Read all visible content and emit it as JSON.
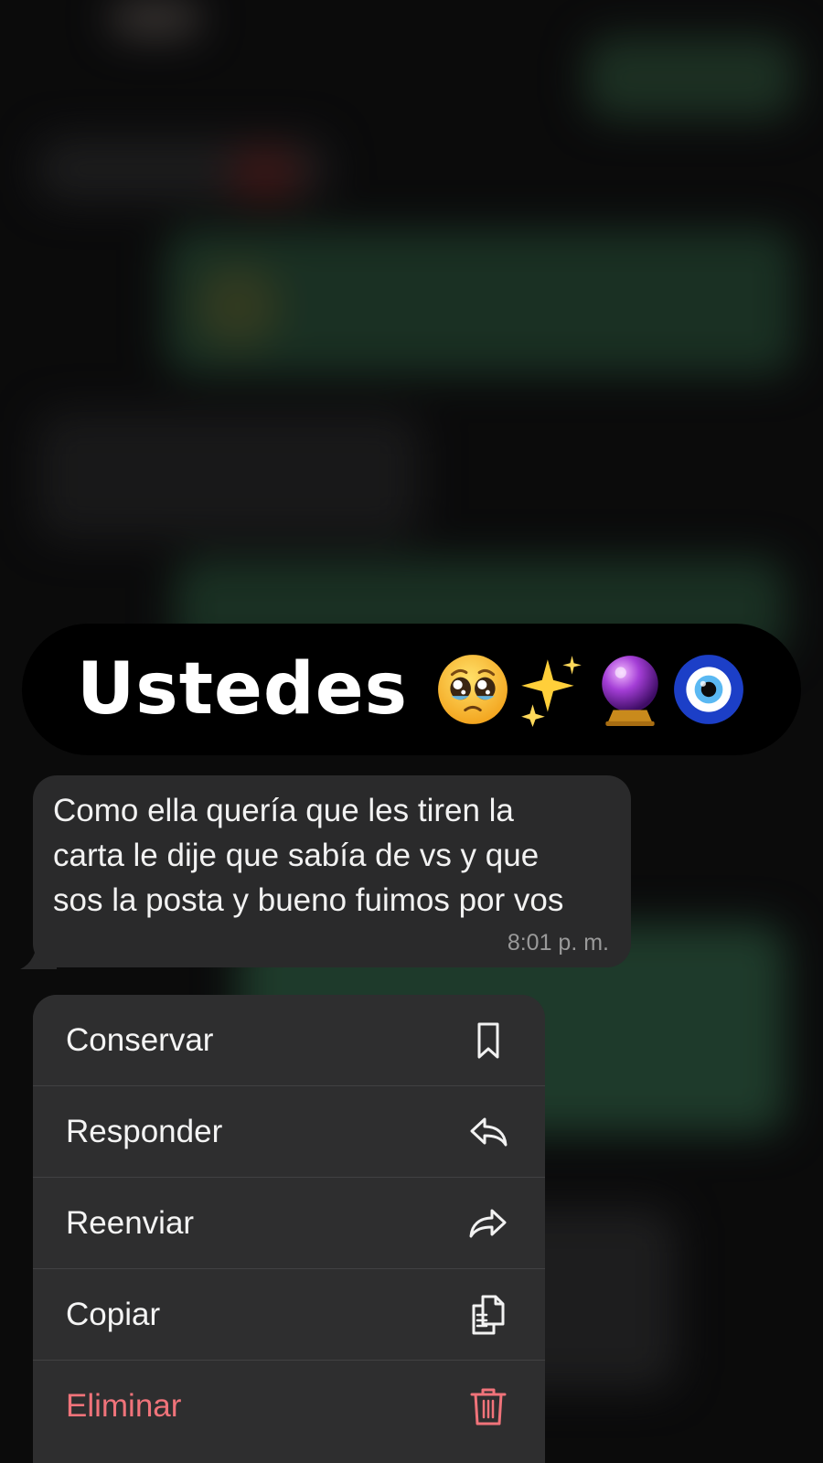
{
  "banner": {
    "title": "Ustedes",
    "emojis": [
      "pleading-face",
      "sparkles",
      "crystal-ball",
      "nazar-amulet"
    ]
  },
  "message": {
    "text": "Como ella quería que les tiren la\ncarta le dije que sabía de vs y que\nsos la posta y bueno fuimos por vos",
    "time": "8:01 p. m."
  },
  "menu": {
    "items": [
      {
        "label": "Conservar",
        "icon": "bookmark-icon"
      },
      {
        "label": "Responder",
        "icon": "reply-icon"
      },
      {
        "label": "Reenviar",
        "icon": "forward-icon"
      },
      {
        "label": "Copiar",
        "icon": "copy-icon"
      },
      {
        "label": "Eliminar",
        "icon": "trash-icon",
        "destructive": true
      }
    ]
  },
  "colors": {
    "background": "#111112",
    "bubble": "#2a2a2b",
    "menu": "#2e2e2f",
    "danger": "#f0737a",
    "chat_green_blurred": "#2f5a42"
  }
}
